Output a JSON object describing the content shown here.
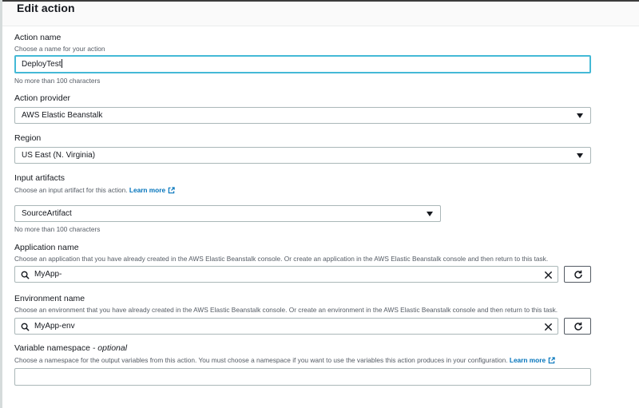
{
  "page": {
    "title": "Edit action"
  },
  "action_name": {
    "label": "Action name",
    "description": "Choose a name for your action",
    "value": "DeployTest",
    "hint": "No more than 100 characters"
  },
  "action_provider": {
    "label": "Action provider",
    "selected": "AWS Elastic Beanstalk"
  },
  "region": {
    "label": "Region",
    "selected": "US East (N. Virginia)"
  },
  "input_artifacts": {
    "label": "Input artifacts",
    "description": "Choose an input artifact for this action.",
    "learn_more": "Learn more",
    "selected": "SourceArtifact",
    "hint": "No more than 100 characters"
  },
  "application_name": {
    "label": "Application name",
    "description": "Choose an application that you have already created in the AWS Elastic Beanstalk console. Or create an application in the AWS Elastic Beanstalk console and then return to this task.",
    "value": "MyApp-"
  },
  "environment_name": {
    "label": "Environment name",
    "description": "Choose an environment that you have already created in the AWS Elastic Beanstalk console. Or create an environment in the AWS Elastic Beanstalk console and then return to this task.",
    "value": "MyApp-env"
  },
  "variable_namespace": {
    "label": "Variable namespace",
    "optional": "- optional",
    "description": "Choose a namespace for the output variables from this action. You must choose a namespace if you want to use the variables this action produces in your configuration.",
    "learn_more": "Learn more",
    "value": ""
  },
  "colors": {
    "link": "#0073bb",
    "focus": "#44b9d6",
    "border": "#aab7b8",
    "text": "#16191f",
    "muted": "#545b64"
  },
  "icons": {
    "dropdown": "caret-down-icon",
    "search": "search-icon",
    "clear": "close-icon",
    "refresh": "refresh-icon",
    "external": "external-link-icon"
  }
}
